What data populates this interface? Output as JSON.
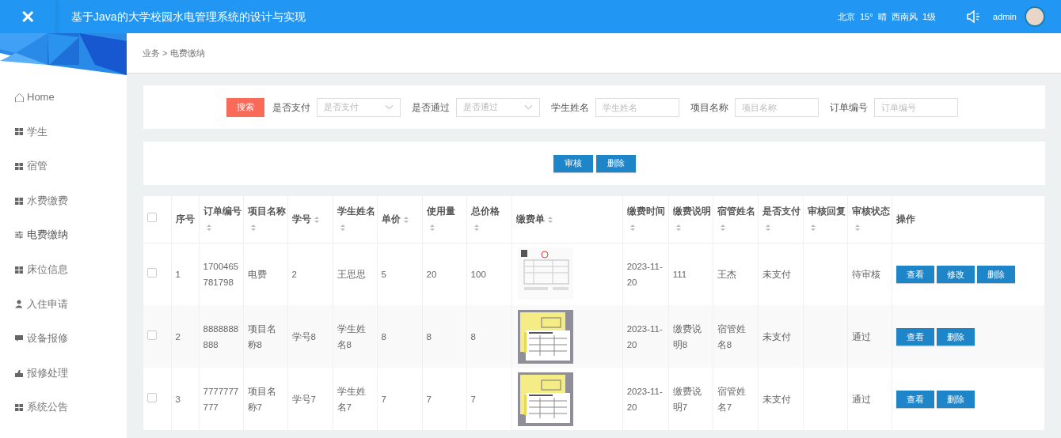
{
  "header": {
    "close_icon": "✕",
    "title": "基于Java的大学校园水电管理系统的设计与实现",
    "weather": "北京  15°  晴  西南风  1级",
    "user": "admin"
  },
  "sidebar": {
    "items": [
      {
        "label": "Home",
        "kind": "home",
        "selected": false
      },
      {
        "label": "学生",
        "kind": "grid",
        "selected": false
      },
      {
        "label": "宿管",
        "kind": "grid",
        "selected": false
      },
      {
        "label": "水费缴费",
        "kind": "grid",
        "selected": false
      },
      {
        "label": "电费缴纳",
        "kind": "sliders",
        "selected": true
      },
      {
        "label": "床位信息",
        "kind": "grid",
        "selected": false
      },
      {
        "label": "入住申请",
        "kind": "user",
        "selected": false
      },
      {
        "label": "设备报修",
        "kind": "comment",
        "selected": false
      },
      {
        "label": "报修处理",
        "kind": "thumb",
        "selected": false
      },
      {
        "label": "系统公告",
        "kind": "grid",
        "selected": false
      }
    ]
  },
  "breadcrumb": "业务 > 电费缴纳",
  "search": {
    "button": "搜索",
    "filters": [
      {
        "kind": "select",
        "label": "是否支付",
        "placeholder": "是否支付"
      },
      {
        "kind": "select",
        "label": "是否通过",
        "placeholder": "是否通过"
      },
      {
        "kind": "text",
        "label": "学生姓名",
        "placeholder": "学生姓名"
      },
      {
        "kind": "text",
        "label": "项目名称",
        "placeholder": "项目名称"
      },
      {
        "kind": "text",
        "label": "订单编号",
        "placeholder": "订单编号"
      }
    ]
  },
  "toolbar": {
    "buttons": [
      "审核",
      "删除"
    ]
  },
  "table": {
    "select_all_checked": false,
    "columns": [
      {
        "label": "序号",
        "sortable": false
      },
      {
        "label": "订单编号",
        "sortable": true
      },
      {
        "label": "项目名称",
        "sortable": true
      },
      {
        "label": "学号",
        "sortable": true
      },
      {
        "label": "学生姓名",
        "sortable": true
      },
      {
        "label": "单价",
        "sortable": true
      },
      {
        "label": "使用量",
        "sortable": true
      },
      {
        "label": "总价格",
        "sortable": true
      },
      {
        "label": "缴费单",
        "sortable": true
      },
      {
        "label": "缴费时间",
        "sortable": true
      },
      {
        "label": "缴费说明",
        "sortable": true
      },
      {
        "label": "宿管姓名",
        "sortable": true
      },
      {
        "label": "是否支付",
        "sortable": true
      },
      {
        "label": "审核回复",
        "sortable": true
      },
      {
        "label": "审核状态",
        "sortable": true
      },
      {
        "label": "操作",
        "sortable": false
      }
    ],
    "rows": [
      {
        "checked": false,
        "cells": [
          "1",
          "1700465781798",
          "电费",
          "2",
          "王思思",
          "5",
          "20",
          "100",
          {
            "kind": "picture"
          },
          "2023-11-20",
          "111",
          "王杰",
          "未支付",
          "",
          "待审核"
        ],
        "actions": [
          "查看",
          "修改",
          "删除"
        ]
      },
      {
        "checked": false,
        "cells": [
          "2",
          "8888888888",
          "项目名称8",
          "学号8",
          "学生姓名8",
          "8",
          "8",
          "8",
          {
            "kind": "picture"
          },
          "2023-11-20",
          "缴费说明8",
          "宿管姓名8",
          "未支付",
          "",
          "通过"
        ],
        "actions": [
          "查看",
          "删除"
        ]
      },
      {
        "checked": false,
        "cells": [
          "3",
          "7777777777",
          "项目名称7",
          "学号7",
          "学生姓名7",
          "7",
          "7",
          "7",
          {
            "kind": "picture"
          },
          "2023-11-20",
          "缴费说明7",
          "宿管姓名7",
          "未支付",
          "",
          "通过"
        ],
        "actions": [
          "查看",
          "删除"
        ]
      }
    ]
  }
}
